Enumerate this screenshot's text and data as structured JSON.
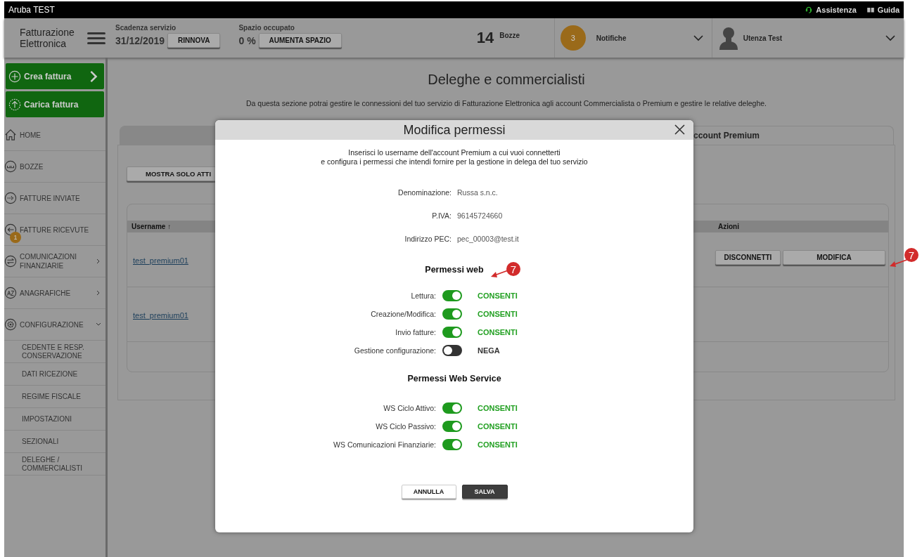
{
  "top_bar": {
    "title": "Aruba TEST",
    "links": [
      {
        "label": "Assistenza"
      },
      {
        "label": "Guida"
      }
    ]
  },
  "header": {
    "logo": [
      "Fatturazione",
      "Elettronica"
    ],
    "service": {
      "label": "Scadenza servizio",
      "value": "31/12/2019",
      "button": "RINNOVA"
    },
    "space": {
      "label": "Spazio occupato",
      "value": "0 %",
      "button": "AUMENTA SPAZIO"
    },
    "drafts": {
      "count": "14",
      "label": "Bozze"
    },
    "notifications": {
      "count": "3",
      "label": "Notifiche"
    },
    "user": {
      "name": "Utenza Test"
    }
  },
  "sidebar": {
    "actions": [
      {
        "label": "Crea fattura",
        "arrow": true
      },
      {
        "label": "Carica fattura",
        "arrow": false
      }
    ],
    "items": [
      {
        "label": "HOME",
        "submenu": false
      },
      {
        "label": "BOZZE",
        "submenu": false
      },
      {
        "label": "FATTURE INVIATE",
        "submenu": false
      },
      {
        "label": "FATTURE RICEVUTE",
        "submenu": false,
        "badge": "1"
      },
      {
        "label": "COMUNICAZIONI FINANZIARIE",
        "submenu": true
      },
      {
        "label": "ANAGRAFICHE",
        "submenu": true
      },
      {
        "label": "CONFIGURAZIONE",
        "submenu": true,
        "expanded": true,
        "children": [
          {
            "label": "CEDENTE E RESP. CONSERVAZIONE"
          },
          {
            "label": "DATI RICEZIONE"
          },
          {
            "label": "REGIME FISCALE"
          },
          {
            "label": "IMPOSTAZIONI"
          },
          {
            "label": "SEZIONALI"
          },
          {
            "label": "DELEGHE / COMMERCIALISTI"
          }
        ]
      }
    ]
  },
  "page": {
    "title": "Deleghe e commercialisti",
    "description": "Da questa sezione potrai gestire le connessioni del tuo servizio di Fatturazione Elettronica agli account Commercialista o Premium e gestire le relative deleghe.",
    "tabs": [
      {
        "selected": false
      },
      {
        "label": "ccount Premium",
        "selected": true
      }
    ],
    "filter_button": "MOSTRA SOLO ATTI",
    "table": {
      "columns": [
        "Username ↑",
        "Azioni"
      ],
      "rows": [
        {
          "username": "test_premium01",
          "actions": [
            "DISCONNETTI",
            "MODIFICA"
          ]
        },
        {
          "username": "test_premium01",
          "actions": []
        }
      ]
    }
  },
  "dialog": {
    "title": "Modifica permessi",
    "intro": [
      "Inserisci lo username dell'account Premium a cui vuoi connetterti",
      "e configura i permessi che intendi fornire per la gestione in delega del tuo servizio"
    ],
    "fields": [
      {
        "label": "Denominazione:",
        "value": "Russa s.n.c.",
        "blurred": true
      },
      {
        "label": "P.IVA:",
        "value": "96145724660",
        "blurred": true
      },
      {
        "label": "Indirizzo PEC:",
        "value": "pec_00003@test.it",
        "blurred": true
      }
    ],
    "sections": [
      {
        "title": "Permessi web",
        "permissions": [
          {
            "label": "Lettura:",
            "on": true,
            "status": "CONSENTI"
          },
          {
            "label": "Creazione/Modifica:",
            "on": true,
            "status": "CONSENTI"
          },
          {
            "label": "Invio fatture:",
            "on": true,
            "status": "CONSENTI"
          },
          {
            "label": "Gestione configurazione:",
            "on": false,
            "status": "NEGA"
          }
        ]
      },
      {
        "title": "Permessi Web Service",
        "permissions": [
          {
            "label": "WS Ciclo Attivo:",
            "on": true,
            "status": "CONSENTI"
          },
          {
            "label": "WS Ciclo Passivo:",
            "on": true,
            "status": "CONSENTI"
          },
          {
            "label": "WS Comunicazioni Finanziarie:",
            "on": true,
            "status": "CONSENTI"
          }
        ]
      }
    ],
    "buttons": [
      {
        "label": "ANNULLA",
        "primary": false
      },
      {
        "label": "SALVA",
        "primary": true
      }
    ]
  },
  "annotations": [
    {
      "label": "7"
    },
    {
      "label": "7"
    }
  ]
}
